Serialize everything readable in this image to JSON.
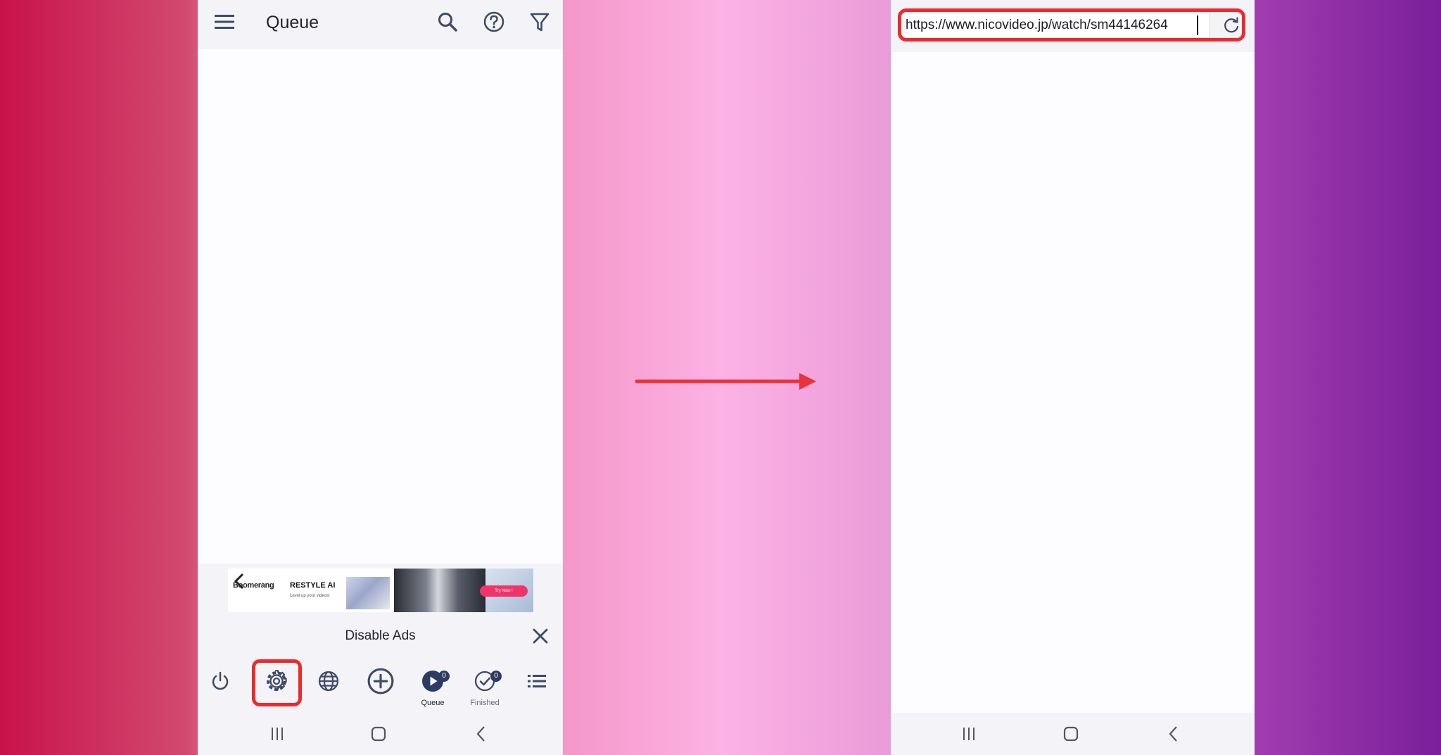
{
  "left_phone": {
    "app_title": "Queue",
    "ad": {
      "brand": "Boomerang",
      "headline": "RESTYLE AI",
      "tagline": "Level up your videos!",
      "cta": "Try Now !"
    },
    "disable_ads_label": "Disable Ads",
    "bottom_nav": {
      "queue_label": "Queue",
      "queue_count": "0",
      "finished_label": "Finished",
      "finished_count": "0"
    }
  },
  "right_phone": {
    "url": "https://www.nicovideo.jp/watch/sm44146264"
  },
  "colors": {
    "highlight": "#ec2a2d",
    "icon_primary": "#2d3b63"
  }
}
